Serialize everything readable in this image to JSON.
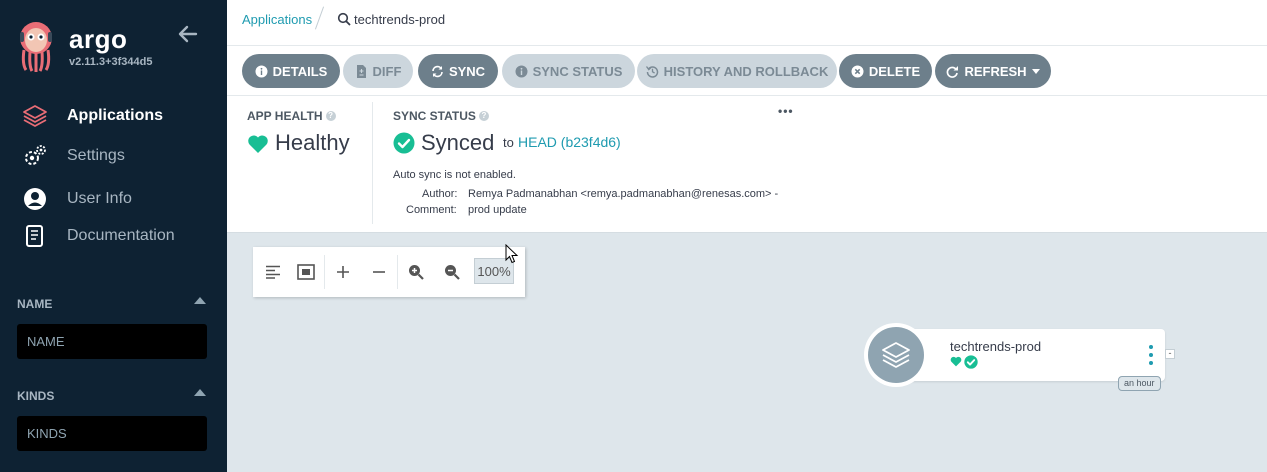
{
  "sidebar": {
    "brand": "argo",
    "version": "v2.11.3+3f344d5",
    "nav": [
      {
        "label": "Applications",
        "icon": "layers-icon",
        "active": true
      },
      {
        "label": "Settings",
        "icon": "gears-icon",
        "active": false
      },
      {
        "label": "User Info",
        "icon": "user-circle-icon",
        "active": false
      },
      {
        "label": "Documentation",
        "icon": "book-icon",
        "active": false
      }
    ],
    "filters": [
      {
        "label": "NAME",
        "placeholder": "NAME"
      },
      {
        "label": "KINDS",
        "placeholder": "KINDS"
      }
    ]
  },
  "breadcrumb": {
    "parent": "Applications",
    "current": "techtrends-prod"
  },
  "toolbar": {
    "buttons": [
      {
        "label": "DETAILS",
        "icon": "info-icon",
        "style": "dark"
      },
      {
        "label": "DIFF",
        "icon": "file-diff-icon",
        "style": "light"
      },
      {
        "label": "SYNC",
        "icon": "sync-icon",
        "style": "dark"
      },
      {
        "label": "SYNC STATUS",
        "icon": "info-icon",
        "style": "light"
      },
      {
        "label": "HISTORY AND ROLLBACK",
        "icon": "history-icon",
        "style": "light"
      },
      {
        "label": "DELETE",
        "icon": "times-circle-icon",
        "style": "dark"
      },
      {
        "label": "REFRESH",
        "icon": "redo-icon",
        "style": "dark"
      }
    ]
  },
  "status": {
    "health_label": "APP HEALTH",
    "health_value": "Healthy",
    "sync_label": "SYNC STATUS",
    "sync_value": "Synced",
    "to_text": "to",
    "revision": "HEAD (b23f4d6)",
    "auto_sync": "Auto sync is not enabled.",
    "author_label": "Author:",
    "author_value": "Remya Padmanabhan <remya.padmanabhan@renesas.com> -",
    "comment_label": "Comment:",
    "comment_value": "prod update",
    "more": "•••"
  },
  "canvas": {
    "zoom": "100%",
    "node": {
      "name": "techtrends-prod",
      "age": "an hour"
    }
  },
  "colors": {
    "sidebar_bg": "#0e2233",
    "accent": "#1f9bb0",
    "healthy": "#18be94",
    "button_dark": "#6d7f8b",
    "button_light": "#ccd6dd"
  }
}
